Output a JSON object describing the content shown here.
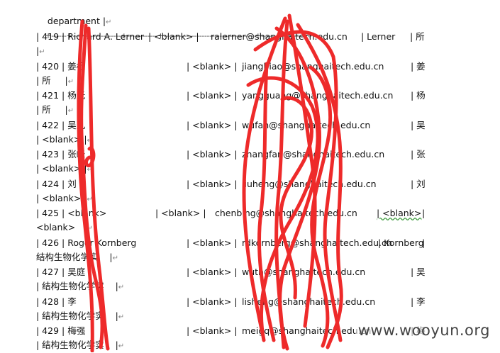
{
  "header": "department |",
  "separator": "+------+-------------------+------------+------------------------------------+----------------+",
  "para_mark": "↵",
  "rows": [
    {
      "id": "| 419 | Richard A. Lerner",
      "blank": "| <blank> |",
      "email": "ralerner@shanghaitech.edu.cn",
      "surname": "| Lerner",
      "dept": "| 所",
      "cont": "|"
    },
    {
      "id": "| 420 | 姜标",
      "blank": "| <blank> |",
      "email": "jiangbiao@shanghaitech.edu.cn",
      "surname": "| 姜",
      "dept": "",
      "cont": "| 所     |"
    },
    {
      "id": "| 421 | 杨光",
      "blank": "| <blank> |",
      "email": "yangguang@shanghaitech.edu.cn",
      "surname": "| 杨",
      "dept": "",
      "cont": "| 所     |"
    },
    {
      "id": "| 422 | 吴凡",
      "blank": "| <blank> |",
      "email": "wufan@shanghaitech.edu.cn",
      "surname": "| 吴",
      "dept": "",
      "cont": "| <blank> |"
    },
    {
      "id": "| 423 | 张峰",
      "blank": "| <blank> |",
      "email": "zhangfan@shanghaitech.edu.cn",
      "surname": "| 张",
      "dept": "",
      "cont": "| <blank> |"
    },
    {
      "id": "| 424 | 刘",
      "blank": "| <blank> |",
      "email": "liuheng@shanghaitech.edu.cn",
      "surname": "| 刘",
      "dept": "",
      "cont": "| <blank> |"
    },
    {
      "id": "| 425 | <blank>",
      "blank": "| <blank> |",
      "email": "chenbing@shanghaitech.edu.cn",
      "surname": "| <blank>",
      "dept": "|",
      "cont": "<blank>   |"
    },
    {
      "id": "| 426 | Roger Kornberg",
      "blank": "| <blank> |",
      "email": "rdkornberg@shanghaitech.edu.cn",
      "surname": "| Kornberg",
      "dept": "|",
      "cont": "结构生物化学实    |"
    },
    {
      "id": "| 427 | 吴庭",
      "blank": "| <blank> |",
      "email": "wuth@shanghaitech.edu.cn",
      "surname": "| 吴",
      "dept": "",
      "cont": "| 结构生物化学实    |"
    },
    {
      "id": "| 428 | 李",
      "blank": "| <blank> |",
      "email": "lisheng@shanghaitech.edu.cn",
      "surname": "| 李",
      "dept": "",
      "cont": "| 结构生物化学实    |"
    },
    {
      "id": "| 429 | 梅强",
      "blank": "| <blank> |",
      "email": "meigq@shanghaitech.edu.cn",
      "surname": "| 梅",
      "dept": "",
      "cont": "| 结构生物化学实    |"
    }
  ],
  "watermark": "www.wooyun.org",
  "colors": {
    "redaction": "#ee2a2a",
    "squiggle": "#3a9a3a"
  }
}
